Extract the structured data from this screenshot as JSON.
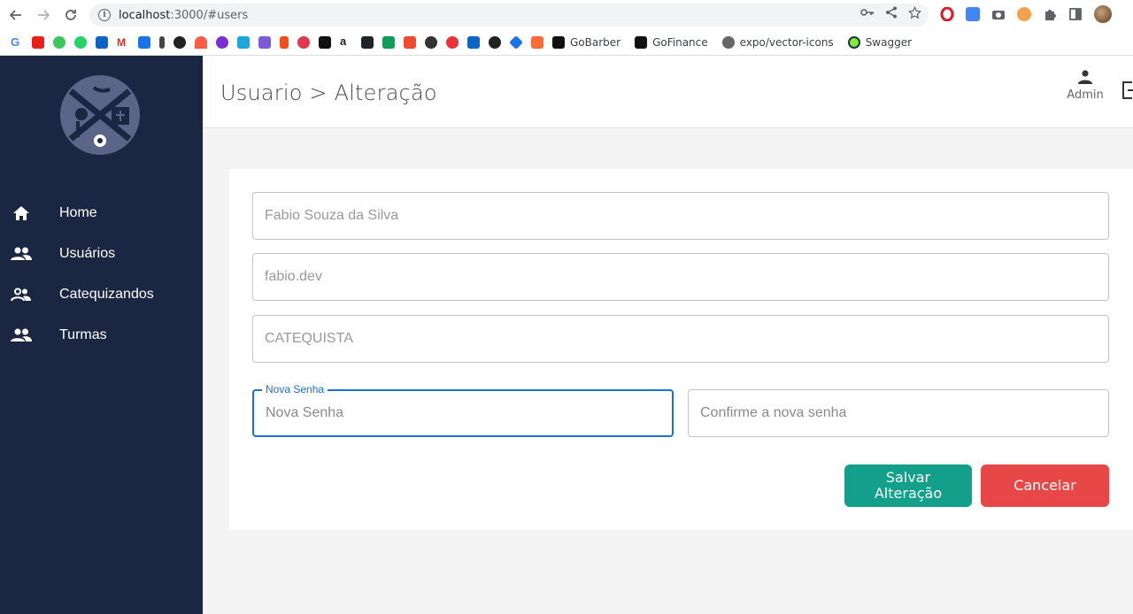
{
  "browser": {
    "url_host": "localhost",
    "url_path": ":3000/#users",
    "bookmarks_named": [
      {
        "label": "GoBarber",
        "icon": "gobarber-icon"
      },
      {
        "label": "GoFinance",
        "icon": "gofinance-icon"
      },
      {
        "label": "expo/vector-icons",
        "icon": "expo-icon"
      },
      {
        "label": "Swagger",
        "icon": "swagger-icon"
      }
    ]
  },
  "sidebar": {
    "items": [
      {
        "label": "Home",
        "icon": "home-icon"
      },
      {
        "label": "Usuários",
        "icon": "users-icon"
      },
      {
        "label": "Catequizandos",
        "icon": "people-outline-icon"
      },
      {
        "label": "Turmas",
        "icon": "groups-icon"
      }
    ]
  },
  "header": {
    "title": "Usuario > Alteração",
    "user_label": "Admin"
  },
  "form": {
    "name_value": "Fabio Souza da Silva",
    "username_value": "fabio.dev",
    "role_value": "CATEQUISTA",
    "new_password_label": "Nova Senha",
    "new_password_placeholder": "Nova Senha",
    "confirm_password_placeholder": "Confirme a nova senha"
  },
  "buttons": {
    "save": "Salvar Alteração",
    "cancel": "Cancelar"
  },
  "colors": {
    "sidebar": "#1b2643",
    "save": "#12a08a",
    "cancel": "#e84747",
    "focus": "#1e6fd6"
  }
}
